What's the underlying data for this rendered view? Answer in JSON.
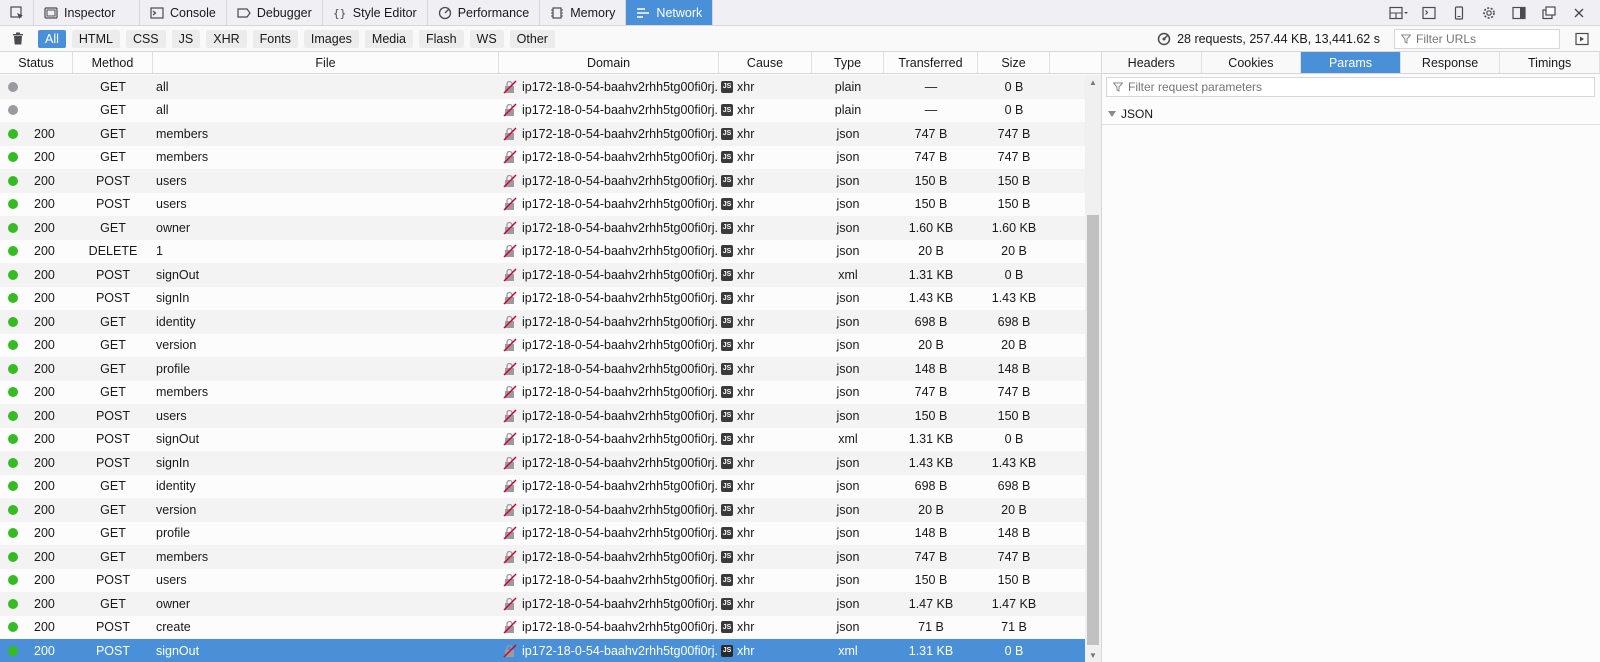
{
  "toolbar": {
    "tabs": [
      {
        "label": "Inspector",
        "icon": "inspector-icon",
        "selected": false
      },
      {
        "label": "Console",
        "icon": "console-icon",
        "selected": false
      },
      {
        "label": "Debugger",
        "icon": "debugger-icon",
        "selected": false
      },
      {
        "label": "Style Editor",
        "icon": "braces-icon",
        "selected": false
      },
      {
        "label": "Performance",
        "icon": "performance-icon",
        "selected": false
      },
      {
        "label": "Memory",
        "icon": "memory-icon",
        "selected": false
      },
      {
        "label": "Network",
        "icon": "network-icon",
        "selected": true
      }
    ],
    "right_icons": [
      "dock-layout-icon",
      "split-console-icon",
      "responsive-design-icon",
      "settings-gear-icon",
      "dock-side-icon",
      "dock-window-icon",
      "close-icon"
    ]
  },
  "filterbar": {
    "buttons": [
      {
        "label": "All",
        "active": true
      },
      {
        "label": "HTML",
        "active": false
      },
      {
        "label": "CSS",
        "active": false
      },
      {
        "label": "JS",
        "active": false
      },
      {
        "label": "XHR",
        "active": false
      },
      {
        "label": "Fonts",
        "active": false
      },
      {
        "label": "Images",
        "active": false
      },
      {
        "label": "Media",
        "active": false
      },
      {
        "label": "Flash",
        "active": false
      },
      {
        "label": "WS",
        "active": false
      },
      {
        "label": "Other",
        "active": false
      }
    ],
    "summary": "28 requests, 257.44 KB, 13,441.62 s",
    "url_filter_placeholder": "Filter URLs"
  },
  "columns": {
    "status": "Status",
    "method": "Method",
    "file": "File",
    "domain": "Domain",
    "cause": "Cause",
    "type": "Type",
    "transferred": "Transferred",
    "size": "Size"
  },
  "requests": [
    {
      "dot": "grey",
      "status": "",
      "method": "GET",
      "file": "all",
      "domain": "ip172-18-0-54-baahv2rhh5tg00fi0rj...",
      "cause": "xhr",
      "type": "plain",
      "transferred": "—",
      "size": "0 B"
    },
    {
      "dot": "grey",
      "status": "",
      "method": "GET",
      "file": "all",
      "domain": "ip172-18-0-54-baahv2rhh5tg00fi0rj...",
      "cause": "xhr",
      "type": "plain",
      "transferred": "—",
      "size": "0 B"
    },
    {
      "dot": "green",
      "status": "200",
      "method": "GET",
      "file": "members",
      "domain": "ip172-18-0-54-baahv2rhh5tg00fi0rj...",
      "cause": "xhr",
      "type": "json",
      "transferred": "747 B",
      "size": "747 B"
    },
    {
      "dot": "green",
      "status": "200",
      "method": "GET",
      "file": "members",
      "domain": "ip172-18-0-54-baahv2rhh5tg00fi0rj...",
      "cause": "xhr",
      "type": "json",
      "transferred": "747 B",
      "size": "747 B"
    },
    {
      "dot": "green",
      "status": "200",
      "method": "POST",
      "file": "users",
      "domain": "ip172-18-0-54-baahv2rhh5tg00fi0rj...",
      "cause": "xhr",
      "type": "json",
      "transferred": "150 B",
      "size": "150 B"
    },
    {
      "dot": "green",
      "status": "200",
      "method": "POST",
      "file": "users",
      "domain": "ip172-18-0-54-baahv2rhh5tg00fi0rj...",
      "cause": "xhr",
      "type": "json",
      "transferred": "150 B",
      "size": "150 B"
    },
    {
      "dot": "green",
      "status": "200",
      "method": "GET",
      "file": "owner",
      "domain": "ip172-18-0-54-baahv2rhh5tg00fi0rj...",
      "cause": "xhr",
      "type": "json",
      "transferred": "1.60 KB",
      "size": "1.60 KB"
    },
    {
      "dot": "green",
      "status": "200",
      "method": "DELETE",
      "file": "1",
      "domain": "ip172-18-0-54-baahv2rhh5tg00fi0rj...",
      "cause": "xhr",
      "type": "json",
      "transferred": "20 B",
      "size": "20 B"
    },
    {
      "dot": "green",
      "status": "200",
      "method": "POST",
      "file": "signOut",
      "domain": "ip172-18-0-54-baahv2rhh5tg00fi0rj...",
      "cause": "xhr",
      "type": "xml",
      "transferred": "1.31 KB",
      "size": "0 B"
    },
    {
      "dot": "green",
      "status": "200",
      "method": "POST",
      "file": "signIn",
      "domain": "ip172-18-0-54-baahv2rhh5tg00fi0rj...",
      "cause": "xhr",
      "type": "json",
      "transferred": "1.43 KB",
      "size": "1.43 KB"
    },
    {
      "dot": "green",
      "status": "200",
      "method": "GET",
      "file": "identity",
      "domain": "ip172-18-0-54-baahv2rhh5tg00fi0rj...",
      "cause": "xhr",
      "type": "json",
      "transferred": "698 B",
      "size": "698 B"
    },
    {
      "dot": "green",
      "status": "200",
      "method": "GET",
      "file": "version",
      "domain": "ip172-18-0-54-baahv2rhh5tg00fi0rj...",
      "cause": "xhr",
      "type": "json",
      "transferred": "20 B",
      "size": "20 B"
    },
    {
      "dot": "green",
      "status": "200",
      "method": "GET",
      "file": "profile",
      "domain": "ip172-18-0-54-baahv2rhh5tg00fi0rj...",
      "cause": "xhr",
      "type": "json",
      "transferred": "148 B",
      "size": "148 B"
    },
    {
      "dot": "green",
      "status": "200",
      "method": "GET",
      "file": "members",
      "domain": "ip172-18-0-54-baahv2rhh5tg00fi0rj...",
      "cause": "xhr",
      "type": "json",
      "transferred": "747 B",
      "size": "747 B"
    },
    {
      "dot": "green",
      "status": "200",
      "method": "POST",
      "file": "users",
      "domain": "ip172-18-0-54-baahv2rhh5tg00fi0rj...",
      "cause": "xhr",
      "type": "json",
      "transferred": "150 B",
      "size": "150 B"
    },
    {
      "dot": "green",
      "status": "200",
      "method": "POST",
      "file": "signOut",
      "domain": "ip172-18-0-54-baahv2rhh5tg00fi0rj...",
      "cause": "xhr",
      "type": "xml",
      "transferred": "1.31 KB",
      "size": "0 B"
    },
    {
      "dot": "green",
      "status": "200",
      "method": "POST",
      "file": "signIn",
      "domain": "ip172-18-0-54-baahv2rhh5tg00fi0rj...",
      "cause": "xhr",
      "type": "json",
      "transferred": "1.43 KB",
      "size": "1.43 KB"
    },
    {
      "dot": "green",
      "status": "200",
      "method": "GET",
      "file": "identity",
      "domain": "ip172-18-0-54-baahv2rhh5tg00fi0rj...",
      "cause": "xhr",
      "type": "json",
      "transferred": "698 B",
      "size": "698 B"
    },
    {
      "dot": "green",
      "status": "200",
      "method": "GET",
      "file": "version",
      "domain": "ip172-18-0-54-baahv2rhh5tg00fi0rj...",
      "cause": "xhr",
      "type": "json",
      "transferred": "20 B",
      "size": "20 B"
    },
    {
      "dot": "green",
      "status": "200",
      "method": "GET",
      "file": "profile",
      "domain": "ip172-18-0-54-baahv2rhh5tg00fi0rj...",
      "cause": "xhr",
      "type": "json",
      "transferred": "148 B",
      "size": "148 B"
    },
    {
      "dot": "green",
      "status": "200",
      "method": "GET",
      "file": "members",
      "domain": "ip172-18-0-54-baahv2rhh5tg00fi0rj...",
      "cause": "xhr",
      "type": "json",
      "transferred": "747 B",
      "size": "747 B"
    },
    {
      "dot": "green",
      "status": "200",
      "method": "POST",
      "file": "users",
      "domain": "ip172-18-0-54-baahv2rhh5tg00fi0rj...",
      "cause": "xhr",
      "type": "json",
      "transferred": "150 B",
      "size": "150 B"
    },
    {
      "dot": "green",
      "status": "200",
      "method": "GET",
      "file": "owner",
      "domain": "ip172-18-0-54-baahv2rhh5tg00fi0rj...",
      "cause": "xhr",
      "type": "json",
      "transferred": "1.47 KB",
      "size": "1.47 KB"
    },
    {
      "dot": "green",
      "status": "200",
      "method": "POST",
      "file": "create",
      "domain": "ip172-18-0-54-baahv2rhh5tg00fi0rj...",
      "cause": "xhr",
      "type": "json",
      "transferred": "71 B",
      "size": "71 B"
    },
    {
      "dot": "green",
      "status": "200",
      "method": "POST",
      "file": "signOut",
      "domain": "ip172-18-0-54-baahv2rhh5tg00fi0rj...",
      "cause": "xhr",
      "type": "xml",
      "transferred": "1.31 KB",
      "size": "0 B",
      "selected": true
    }
  ],
  "cause_badge": "JS",
  "sidepanel": {
    "tabs": [
      {
        "label": "Headers",
        "selected": false
      },
      {
        "label": "Cookies",
        "selected": false
      },
      {
        "label": "Params",
        "selected": true
      },
      {
        "label": "Response",
        "selected": false
      },
      {
        "label": "Timings",
        "selected": false
      }
    ],
    "param_filter_placeholder": "Filter request parameters",
    "section_label": "JSON"
  },
  "colors": {
    "accent": "#4a90d9",
    "status_ok": "#35bc22",
    "status_pending": "#9a9aa0"
  }
}
